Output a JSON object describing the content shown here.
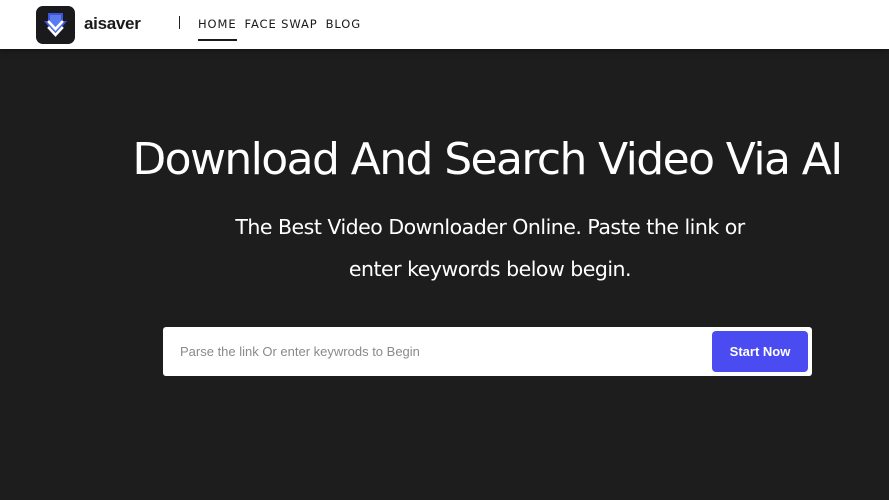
{
  "header": {
    "brand_name": "aisaver",
    "nav": [
      {
        "label": "HOME",
        "active": true
      },
      {
        "label": "FACE SWAP",
        "active": false
      },
      {
        "label": "BLOG",
        "active": false
      }
    ]
  },
  "hero": {
    "title": "Download And Search Video Via AI",
    "subtitle_line1": "The Best Video Downloader Online. Paste the link or",
    "subtitle_line2": "enter keywords below begin."
  },
  "search": {
    "placeholder": "Parse the link Or enter keywrods to Begin",
    "value": "",
    "button_label": "Start Now"
  },
  "colors": {
    "background": "#1e1d1e",
    "header": "#ffffff",
    "accent": "#4a4cf2"
  },
  "icons": {
    "logo": "download-arrow-icon"
  }
}
